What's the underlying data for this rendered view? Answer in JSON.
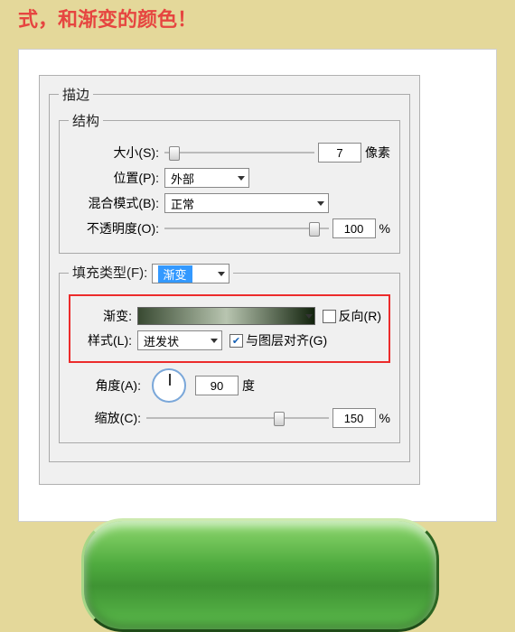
{
  "intro": "式，和渐变的颜色！",
  "panel_title": "描边",
  "structure": {
    "legend": "结构",
    "size": {
      "label": "大小(S):",
      "value": "7",
      "unit": "像素",
      "thumb_pct": 3
    },
    "position": {
      "label": "位置(P):",
      "value": "外部"
    },
    "blend": {
      "label": "混合模式(B):",
      "value": "正常"
    },
    "opacity": {
      "label": "不透明度(O):",
      "value": "100",
      "unit": "%",
      "thumb_pct": 88
    }
  },
  "fill": {
    "type_label": "填充类型(F):",
    "type_value": "渐变",
    "gradient_label": "渐变:",
    "reverse_label": "反向(R)",
    "reverse_checked": false,
    "style_label": "样式(L):",
    "style_value": "迸发状",
    "align_label": "与图层对齐(G)",
    "align_checked": true,
    "angle_label": "角度(A):",
    "angle_value": "90",
    "angle_unit": "度",
    "scale_label": "缩放(C):",
    "scale_value": "150",
    "scale_unit": "%",
    "scale_thumb_pct": 70
  }
}
